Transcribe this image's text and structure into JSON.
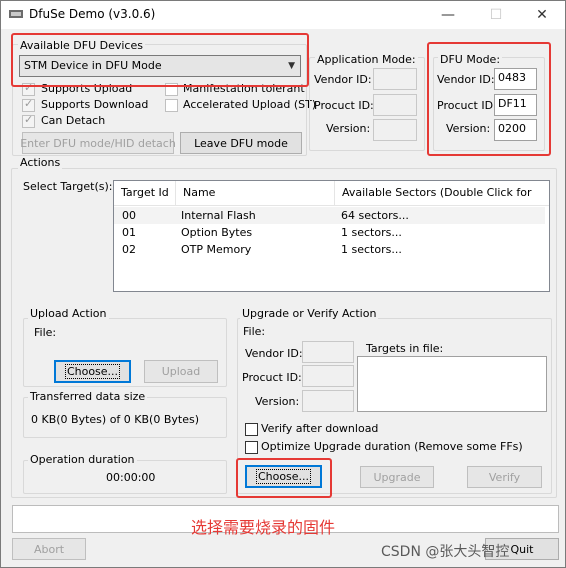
{
  "window": {
    "title": "DfuSe Demo (v3.0.6)",
    "controls": {
      "minimize": "—",
      "maximize": "☐",
      "close": "✕"
    }
  },
  "devices": {
    "legend": "Available DFU Devices",
    "selected": "STM Device in DFU Mode",
    "checkboxes": [
      {
        "label": "Supports Upload",
        "checked": true
      },
      {
        "label": "Supports Download",
        "checked": true
      },
      {
        "label": "Can Detach",
        "checked": true
      },
      {
        "label": "Manifestation tolerant",
        "checked": false
      },
      {
        "label": "Accelerated Upload (ST)",
        "checked": false
      }
    ],
    "enter_dfu_label": "Enter DFU mode/HID detach",
    "leave_dfu_label": "Leave DFU mode"
  },
  "app_mode": {
    "legend": "Application Mode:",
    "vendor_label": "Vendor ID:",
    "product_label": "Procuct ID:",
    "version_label": "Version:",
    "vendor_value": "",
    "product_value": "",
    "version_value": ""
  },
  "dfu_mode": {
    "legend": "DFU Mode:",
    "vendor_label": "Vendor ID:",
    "product_label": "Procuct ID:",
    "version_label": "Version:",
    "vendor_value": "0483",
    "product_value": "DF11",
    "version_value": "0200"
  },
  "actions": {
    "legend": "Actions",
    "select_target_label": "Select Target(s):",
    "columns": [
      "Target Id",
      "Name",
      "Available Sectors (Double Click for more)"
    ],
    "rows": [
      {
        "id": "00",
        "name": "Internal Flash",
        "sectors": "64 sectors..."
      },
      {
        "id": "01",
        "name": "Option Bytes",
        "sectors": "1 sectors..."
      },
      {
        "id": "02",
        "name": "OTP Memory",
        "sectors": "1 sectors..."
      }
    ]
  },
  "upload": {
    "legend": "Upload Action",
    "file_label": "File:",
    "choose_label": "Choose...",
    "upload_label": "Upload"
  },
  "transferred": {
    "legend": "Transferred data size",
    "value": "0 KB(0 Bytes) of 0 KB(0 Bytes)"
  },
  "duration": {
    "legend": "Operation duration",
    "value": "00:00:00"
  },
  "upgrade": {
    "legend": "Upgrade or Verify Action",
    "file_label": "File:",
    "vendor_label": "Vendor ID:",
    "product_label": "Procuct ID:",
    "version_label": "Version:",
    "targets_label": "Targets in file:",
    "verify_after_label": "Verify after download",
    "optimize_label": "Optimize Upgrade duration (Remove some FFs)",
    "choose_label": "Choose...",
    "upgrade_label": "Upgrade",
    "verify_label": "Verify"
  },
  "bottom": {
    "abort_label": "Abort",
    "quit_label": "Quit"
  },
  "annotation": "选择需要烧录的固件",
  "watermark": "CSDN @张大头智控",
  "colors": {
    "highlight": "#e53935",
    "focus": "#0078d7"
  }
}
